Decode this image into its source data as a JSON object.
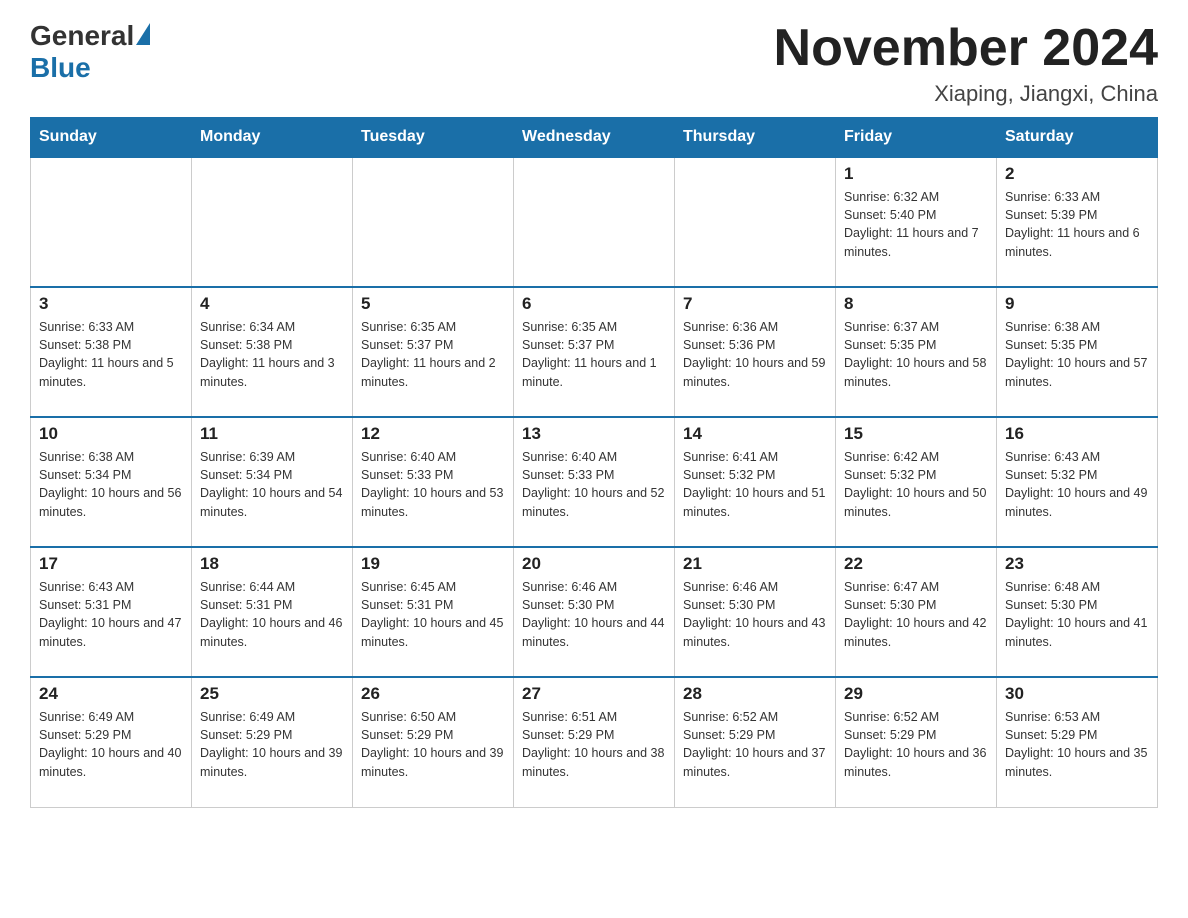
{
  "header": {
    "logo_general": "General",
    "logo_blue": "Blue",
    "month_year": "November 2024",
    "location": "Xiaping, Jiangxi, China"
  },
  "weekdays": [
    "Sunday",
    "Monday",
    "Tuesday",
    "Wednesday",
    "Thursday",
    "Friday",
    "Saturday"
  ],
  "weeks": [
    [
      {
        "day": "",
        "info": ""
      },
      {
        "day": "",
        "info": ""
      },
      {
        "day": "",
        "info": ""
      },
      {
        "day": "",
        "info": ""
      },
      {
        "day": "",
        "info": ""
      },
      {
        "day": "1",
        "info": "Sunrise: 6:32 AM\nSunset: 5:40 PM\nDaylight: 11 hours and 7 minutes."
      },
      {
        "day": "2",
        "info": "Sunrise: 6:33 AM\nSunset: 5:39 PM\nDaylight: 11 hours and 6 minutes."
      }
    ],
    [
      {
        "day": "3",
        "info": "Sunrise: 6:33 AM\nSunset: 5:38 PM\nDaylight: 11 hours and 5 minutes."
      },
      {
        "day": "4",
        "info": "Sunrise: 6:34 AM\nSunset: 5:38 PM\nDaylight: 11 hours and 3 minutes."
      },
      {
        "day": "5",
        "info": "Sunrise: 6:35 AM\nSunset: 5:37 PM\nDaylight: 11 hours and 2 minutes."
      },
      {
        "day": "6",
        "info": "Sunrise: 6:35 AM\nSunset: 5:37 PM\nDaylight: 11 hours and 1 minute."
      },
      {
        "day": "7",
        "info": "Sunrise: 6:36 AM\nSunset: 5:36 PM\nDaylight: 10 hours and 59 minutes."
      },
      {
        "day": "8",
        "info": "Sunrise: 6:37 AM\nSunset: 5:35 PM\nDaylight: 10 hours and 58 minutes."
      },
      {
        "day": "9",
        "info": "Sunrise: 6:38 AM\nSunset: 5:35 PM\nDaylight: 10 hours and 57 minutes."
      }
    ],
    [
      {
        "day": "10",
        "info": "Sunrise: 6:38 AM\nSunset: 5:34 PM\nDaylight: 10 hours and 56 minutes."
      },
      {
        "day": "11",
        "info": "Sunrise: 6:39 AM\nSunset: 5:34 PM\nDaylight: 10 hours and 54 minutes."
      },
      {
        "day": "12",
        "info": "Sunrise: 6:40 AM\nSunset: 5:33 PM\nDaylight: 10 hours and 53 minutes."
      },
      {
        "day": "13",
        "info": "Sunrise: 6:40 AM\nSunset: 5:33 PM\nDaylight: 10 hours and 52 minutes."
      },
      {
        "day": "14",
        "info": "Sunrise: 6:41 AM\nSunset: 5:32 PM\nDaylight: 10 hours and 51 minutes."
      },
      {
        "day": "15",
        "info": "Sunrise: 6:42 AM\nSunset: 5:32 PM\nDaylight: 10 hours and 50 minutes."
      },
      {
        "day": "16",
        "info": "Sunrise: 6:43 AM\nSunset: 5:32 PM\nDaylight: 10 hours and 49 minutes."
      }
    ],
    [
      {
        "day": "17",
        "info": "Sunrise: 6:43 AM\nSunset: 5:31 PM\nDaylight: 10 hours and 47 minutes."
      },
      {
        "day": "18",
        "info": "Sunrise: 6:44 AM\nSunset: 5:31 PM\nDaylight: 10 hours and 46 minutes."
      },
      {
        "day": "19",
        "info": "Sunrise: 6:45 AM\nSunset: 5:31 PM\nDaylight: 10 hours and 45 minutes."
      },
      {
        "day": "20",
        "info": "Sunrise: 6:46 AM\nSunset: 5:30 PM\nDaylight: 10 hours and 44 minutes."
      },
      {
        "day": "21",
        "info": "Sunrise: 6:46 AM\nSunset: 5:30 PM\nDaylight: 10 hours and 43 minutes."
      },
      {
        "day": "22",
        "info": "Sunrise: 6:47 AM\nSunset: 5:30 PM\nDaylight: 10 hours and 42 minutes."
      },
      {
        "day": "23",
        "info": "Sunrise: 6:48 AM\nSunset: 5:30 PM\nDaylight: 10 hours and 41 minutes."
      }
    ],
    [
      {
        "day": "24",
        "info": "Sunrise: 6:49 AM\nSunset: 5:29 PM\nDaylight: 10 hours and 40 minutes."
      },
      {
        "day": "25",
        "info": "Sunrise: 6:49 AM\nSunset: 5:29 PM\nDaylight: 10 hours and 39 minutes."
      },
      {
        "day": "26",
        "info": "Sunrise: 6:50 AM\nSunset: 5:29 PM\nDaylight: 10 hours and 39 minutes."
      },
      {
        "day": "27",
        "info": "Sunrise: 6:51 AM\nSunset: 5:29 PM\nDaylight: 10 hours and 38 minutes."
      },
      {
        "day": "28",
        "info": "Sunrise: 6:52 AM\nSunset: 5:29 PM\nDaylight: 10 hours and 37 minutes."
      },
      {
        "day": "29",
        "info": "Sunrise: 6:52 AM\nSunset: 5:29 PM\nDaylight: 10 hours and 36 minutes."
      },
      {
        "day": "30",
        "info": "Sunrise: 6:53 AM\nSunset: 5:29 PM\nDaylight: 10 hours and 35 minutes."
      }
    ]
  ]
}
